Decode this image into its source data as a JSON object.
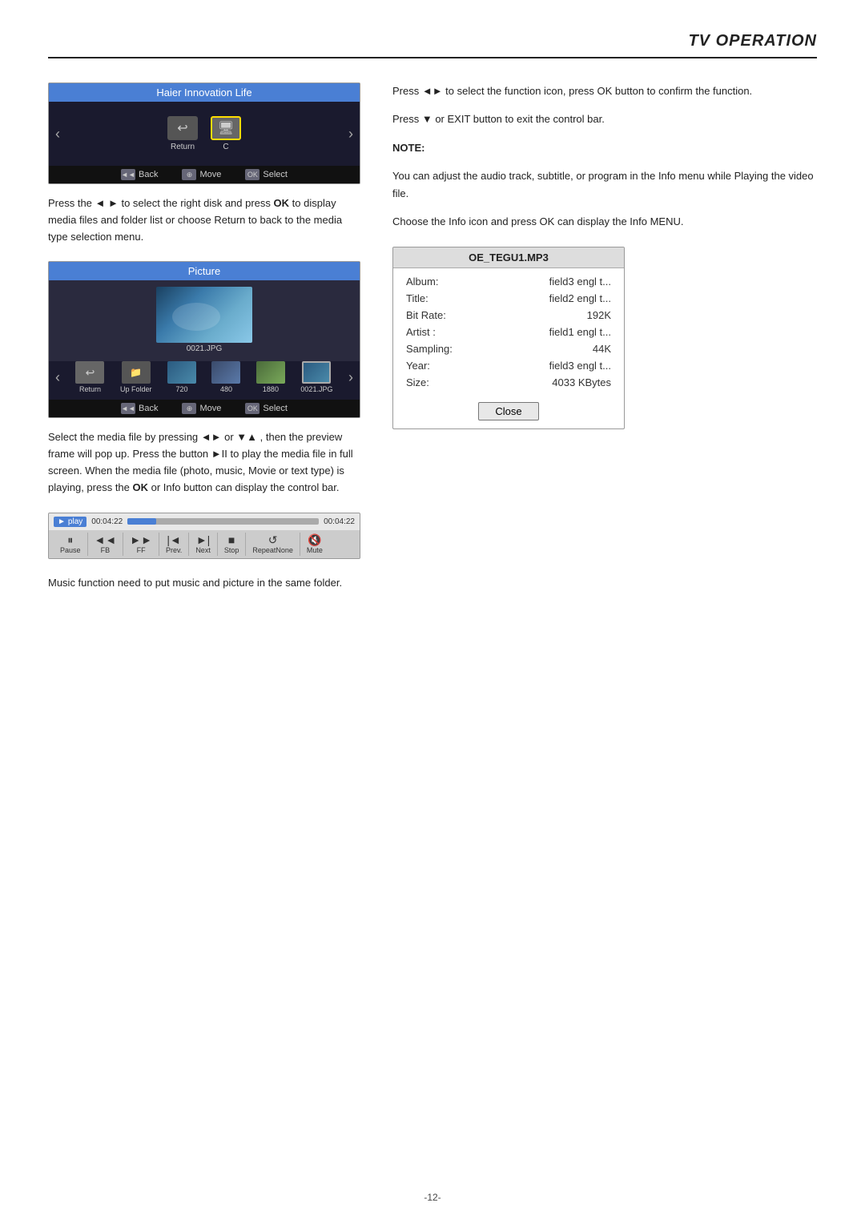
{
  "header": {
    "title": "TV OPERATION"
  },
  "left": {
    "disk_browser": {
      "title": "Haier Innovation Life",
      "left_arrow": "‹",
      "right_arrow": "›",
      "icons": [
        {
          "label": "Return",
          "selected": false
        },
        {
          "label": "C",
          "selected": true
        }
      ],
      "bottom_buttons": [
        {
          "icon": "back",
          "label": "Back"
        },
        {
          "icon": "move",
          "label": "Move"
        },
        {
          "icon": "ok",
          "label": "Select"
        }
      ]
    },
    "desc1": "Press the ◄ ► to select the right disk and press OK to display media files and folder list or choose Return to back to the media type selection menu.",
    "picture_browser": {
      "title": "Picture",
      "filename": "0021.JPG",
      "left_arrow": "‹",
      "right_arrow": "›",
      "thumbnails": [
        {
          "type": "folder",
          "label": "Return"
        },
        {
          "type": "up-folder",
          "label": "Up Folder"
        },
        {
          "type": "img",
          "label": "720"
        },
        {
          "type": "img2",
          "label": "480"
        },
        {
          "type": "img3",
          "label": "1880"
        },
        {
          "type": "selected",
          "label": "0021.JPG"
        }
      ],
      "bottom_buttons": [
        {
          "label": "Back"
        },
        {
          "label": "Move"
        },
        {
          "label": "Select"
        }
      ]
    },
    "desc2": "Select the media file by pressing ◄► or ▼▲ , then the preview frame will pop up. Press the button ►II to play the media file in full screen. When the media file (photo, music, Movie or text type) is playing, press the OK or Info button can display the control bar.",
    "control_bar": {
      "status": "►play",
      "time_start": "00:04:22",
      "time_end": "00:04:22",
      "progress_percent": 15,
      "buttons": [
        {
          "icon": "⏸",
          "label": "Pause"
        },
        {
          "icon": "◄",
          "label": "FB"
        },
        {
          "icon": "►",
          "label": "FF"
        },
        {
          "icon": "|◄",
          "label": "Prev."
        },
        {
          "icon": "►|",
          "label": "Next"
        },
        {
          "icon": "■",
          "label": "Stop"
        },
        {
          "icon": "↺",
          "label": "RepeatNone"
        },
        {
          "icon": "🔇",
          "label": "Mute"
        }
      ]
    },
    "music_note": "Music function need to put music and picture in the same folder."
  },
  "right": {
    "para1": "Press ◄► to select the function icon,  press OK button to confirm  the function.",
    "para2": "Press ▼ or EXIT button to exit the control bar.",
    "note_label": "NOTE:",
    "note1": "You can adjust the audio track, subtitle, or program in the Info menu while Playing the video file.",
    "note2": "Choose the Info icon and press OK can display the Info MENU.",
    "info_card": {
      "title": "OE_TEGU1.MP3",
      "rows": [
        {
          "field": "Album:",
          "value": "field3  engl t..."
        },
        {
          "field": "Title:",
          "value": "field2  engl t..."
        },
        {
          "field": "Bit Rate:",
          "value": "192K"
        },
        {
          "field": "Artist :",
          "value": "field1  engl t..."
        },
        {
          "field": "Sampling:",
          "value": "44K"
        },
        {
          "field": "Year:",
          "value": "field3  engl t..."
        },
        {
          "field": "Size:",
          "value": "4033 KBytes"
        }
      ],
      "close_button": "Close"
    }
  },
  "footer": {
    "page_number": "-12-"
  }
}
